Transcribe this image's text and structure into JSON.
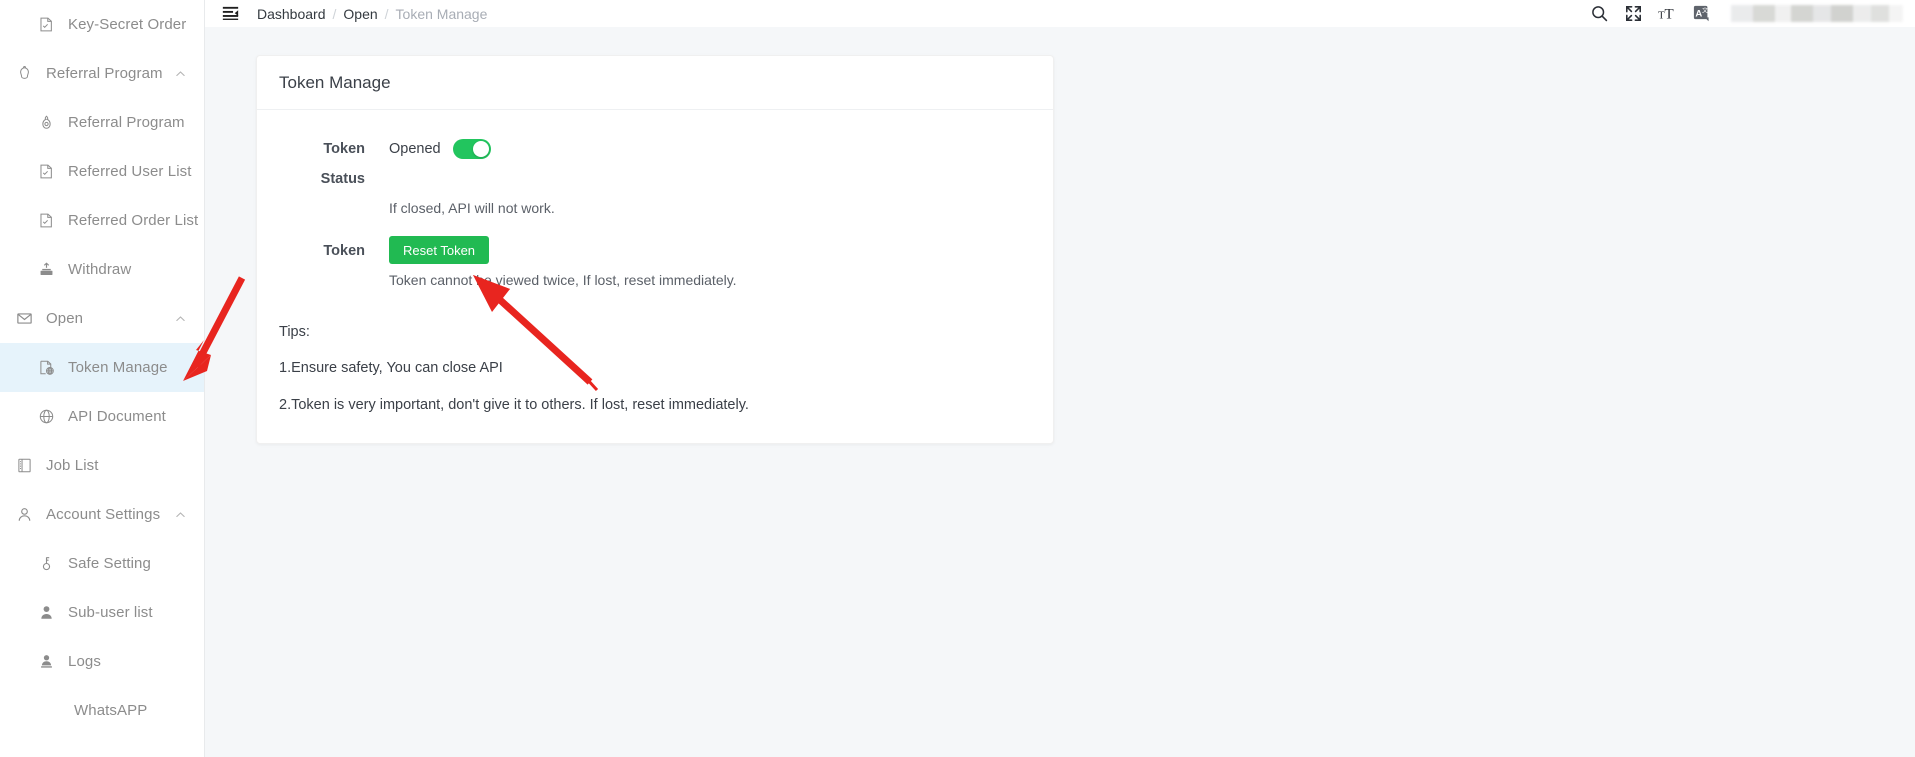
{
  "sidebar": {
    "items": [
      {
        "label": "Key-Secret Order",
        "icon": "document-check-icon",
        "level": 2,
        "active": false,
        "expandable": false
      },
      {
        "label": "Referral Program",
        "icon": "gift-icon",
        "level": 1,
        "active": false,
        "expandable": true,
        "expanded": true
      },
      {
        "label": "Referral Program",
        "icon": "bag-icon",
        "level": 2,
        "active": false,
        "expandable": false
      },
      {
        "label": "Referred User List",
        "icon": "document-check-icon",
        "level": 2,
        "active": false,
        "expandable": false
      },
      {
        "label": "Referred Order List",
        "icon": "document-check-icon",
        "level": 2,
        "active": false,
        "expandable": false
      },
      {
        "label": "Withdraw",
        "icon": "withdraw-icon",
        "level": 2,
        "active": false,
        "expandable": false
      },
      {
        "label": "Open",
        "icon": "envelope-icon",
        "level": 1,
        "active": false,
        "expandable": true,
        "expanded": true
      },
      {
        "label": "Token Manage",
        "icon": "token-icon",
        "level": 2,
        "active": true,
        "expandable": false
      },
      {
        "label": "API Document",
        "icon": "globe-icon",
        "level": 2,
        "active": false,
        "expandable": false
      },
      {
        "label": "Job List",
        "icon": "book-icon",
        "level": 1,
        "active": false,
        "expandable": false
      },
      {
        "label": "Account Settings",
        "icon": "user-icon",
        "level": 1,
        "active": false,
        "expandable": true,
        "expanded": true
      },
      {
        "label": "Safe Setting",
        "icon": "key-icon",
        "level": 2,
        "active": false,
        "expandable": false
      },
      {
        "label": "Sub-user list",
        "icon": "user-filled-icon",
        "level": 2,
        "active": false,
        "expandable": false
      },
      {
        "label": "Logs",
        "icon": "user-log-icon",
        "level": 2,
        "active": false,
        "expandable": false
      },
      {
        "label": "WhatsAPP",
        "icon": "none",
        "level": 2,
        "active": false,
        "expandable": false
      }
    ]
  },
  "header": {
    "menu_toggle_icon": "hamburger-icon",
    "breadcrumb": [
      {
        "label": "Dashboard",
        "current": false
      },
      {
        "label": "Open",
        "current": false
      },
      {
        "label": "Token Manage",
        "current": true
      }
    ],
    "separator": "/",
    "actions": [
      {
        "name": "search-icon",
        "label": "Search"
      },
      {
        "name": "fullscreen-icon",
        "label": "Fullscreen"
      },
      {
        "name": "font-size-icon",
        "label": "Font Size"
      },
      {
        "name": "translate-icon",
        "label": "Translate"
      }
    ],
    "user_redacted": true
  },
  "card": {
    "title": "Token Manage",
    "token_status": {
      "label": "Token Status",
      "value": "Opened",
      "enabled": true,
      "hint": "If closed, API will not work."
    },
    "token": {
      "label": "Token",
      "button_label": "Reset Token",
      "hint": "Token cannot be viewed twice, If lost, reset immediately."
    },
    "tips": {
      "title": "Tips:",
      "lines": [
        "1.Ensure safety, You can close API",
        "2.Token is very important, don't give it to others. If lost, reset immediately."
      ]
    }
  },
  "colors": {
    "toggle_on": "#22c55e",
    "reset_button": "#21ba52",
    "active_menu_bg": "#e6f3fb",
    "annotation_arrow": "#e8251f",
    "content_bg": "#f5f7f9"
  },
  "annotations": [
    {
      "name": "arrow-to-token-manage-menu",
      "color": "#e8251f"
    },
    {
      "name": "arrow-to-reset-token-button",
      "color": "#e8251f"
    }
  ]
}
